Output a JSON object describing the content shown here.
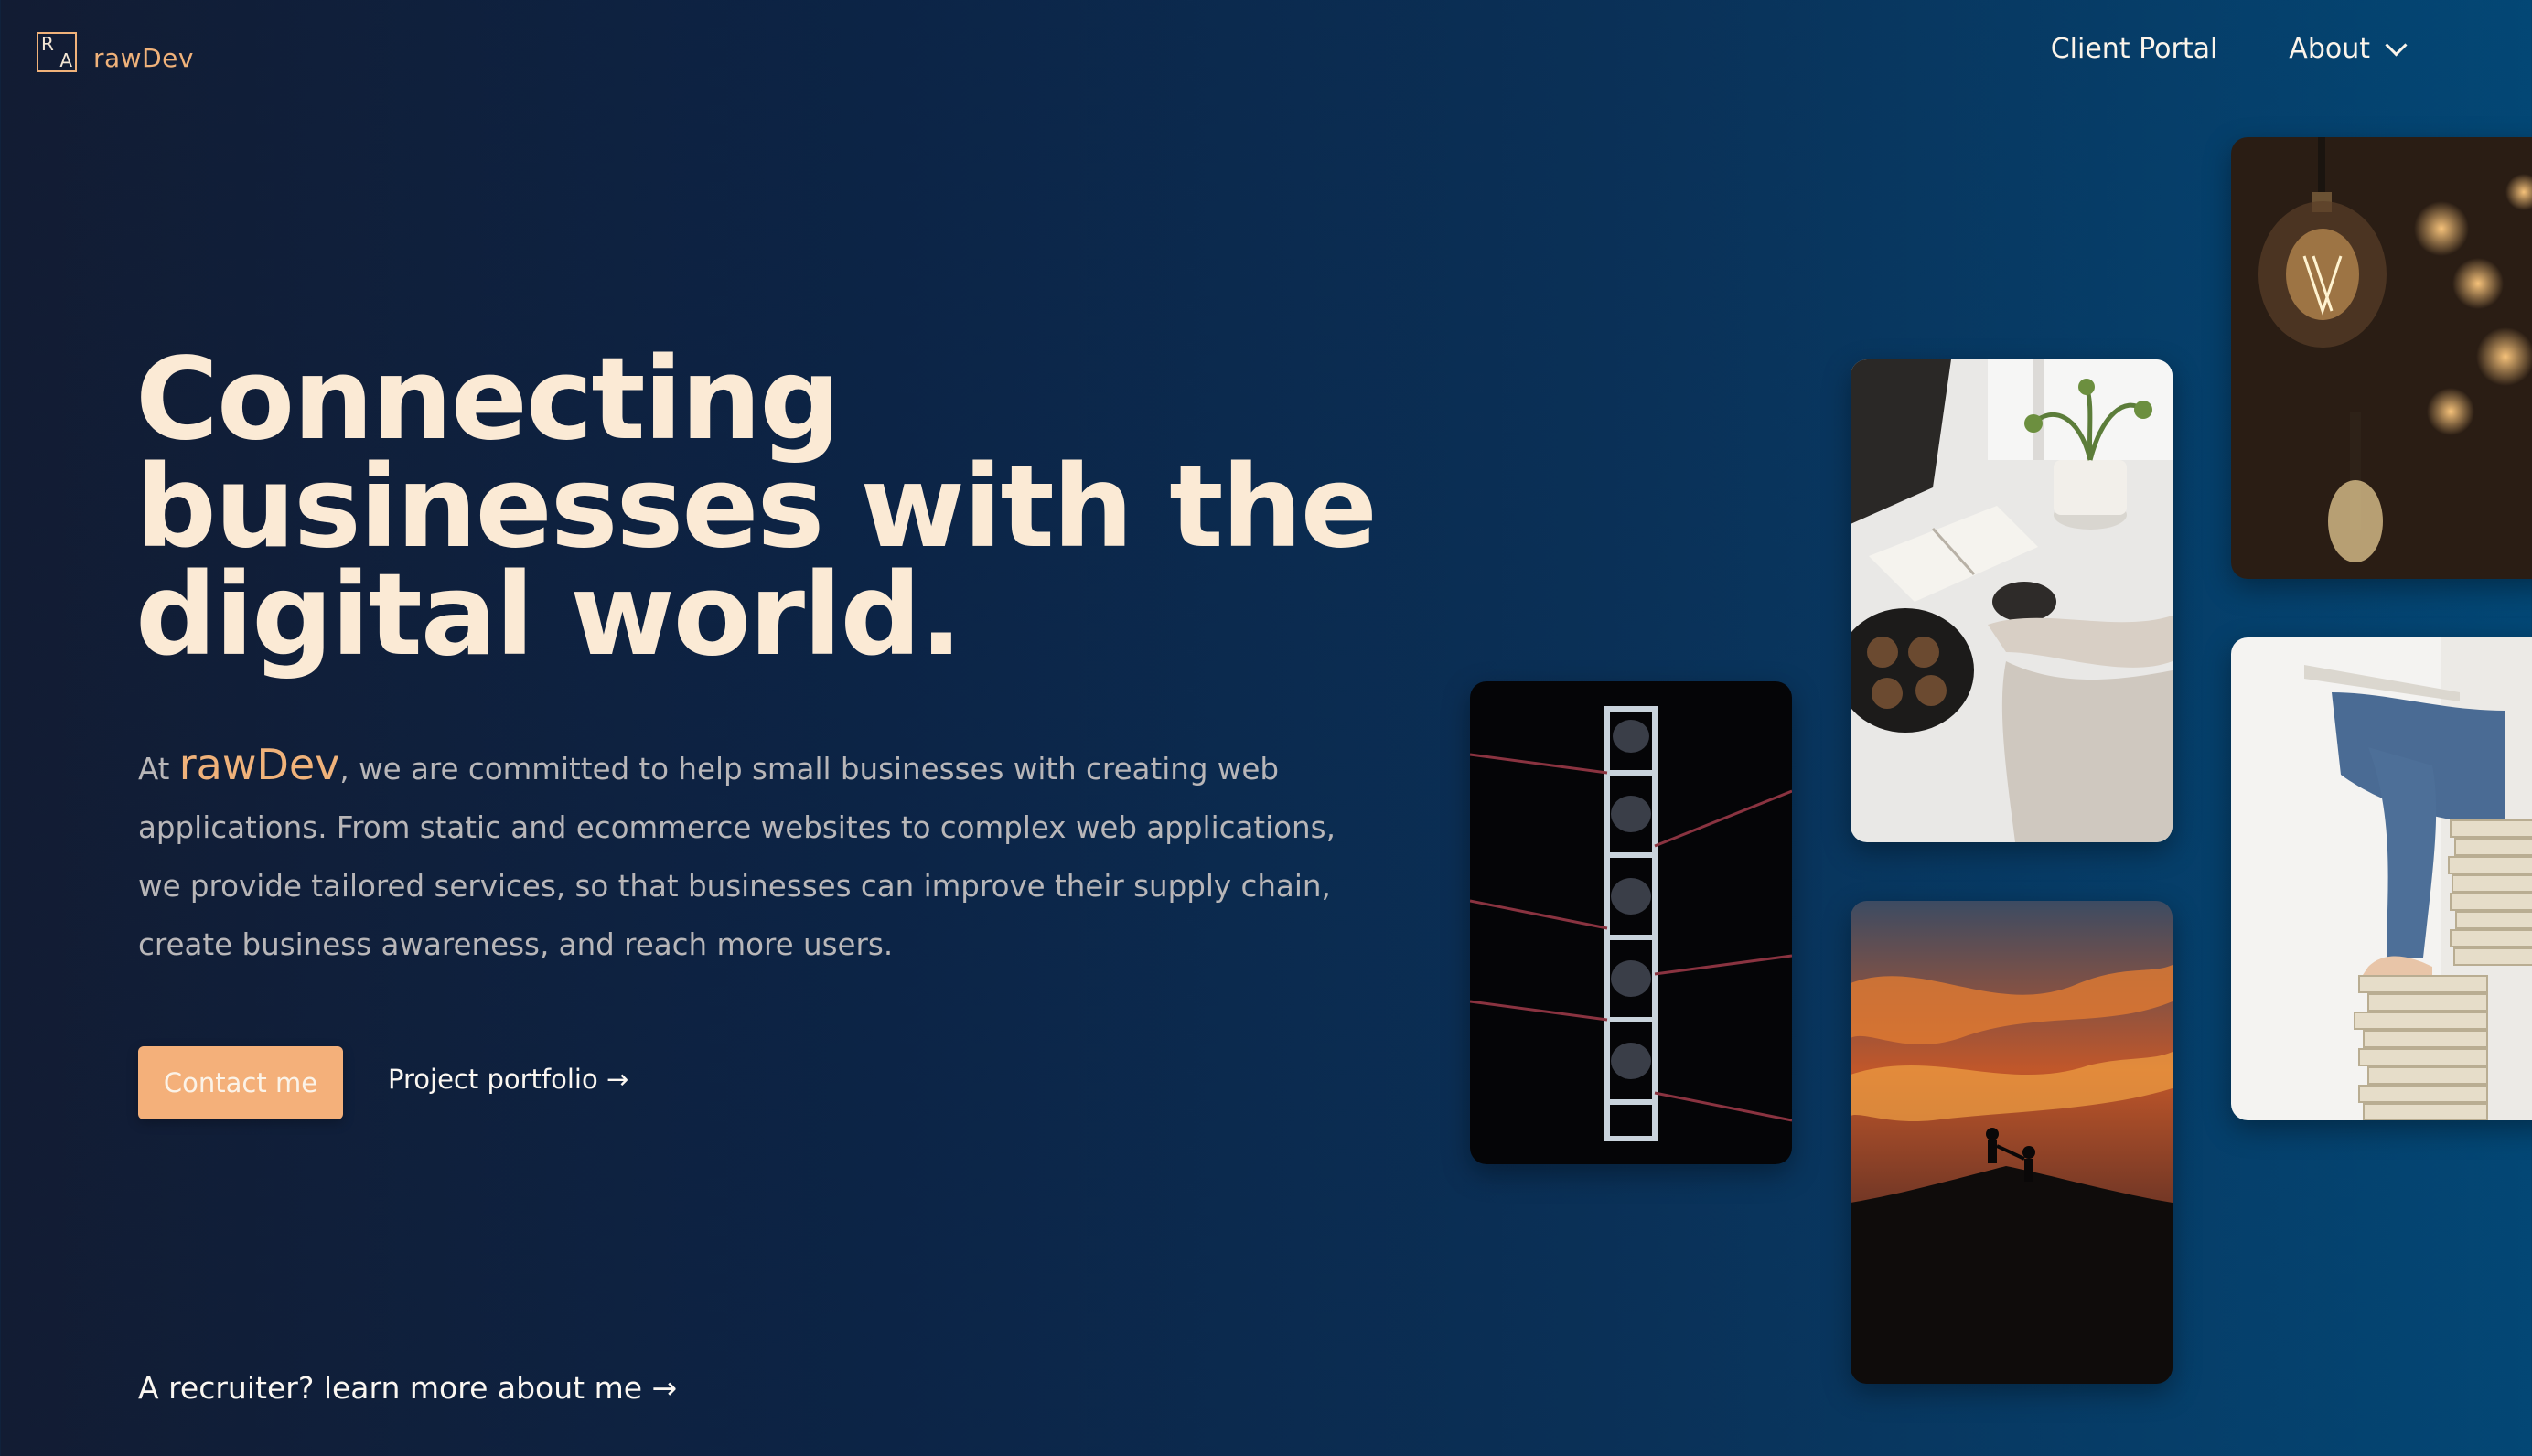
{
  "header": {
    "logo_r": "R",
    "logo_a": "A",
    "logo_text": "rawDev",
    "nav": {
      "client_portal": "Client Portal",
      "about": "About"
    }
  },
  "hero": {
    "title_line1": "Connecting",
    "title_line2": "businesses with the",
    "title_line3": "digital world.",
    "intro_prefix": "At ",
    "brand": "rawDev",
    "intro_body": ", we are committed to help small businesses with creating web applications. From static and ecommerce websites to complex web applications, we provide tailored services, so that businesses can improve their supply chain, create business awareness, and reach more users.",
    "contact_button": "Contact me",
    "portfolio_link": "Project portfolio →",
    "recruiter_link": "A recruiter? learn more about me →"
  },
  "images": {
    "rowers": "rowing-crew-photo",
    "coffee": "coffee-and-book-photo",
    "climb": "sunset-climbers-photo",
    "bulb": "light-bulb-photo",
    "books": "stack-of-books-photo"
  },
  "colors": {
    "accent": "#f0b27a",
    "button": "#f4b07a",
    "headline": "#fbead5",
    "body_text": "#b8b6b8",
    "bg_left": "#121c33",
    "bg_right": "#034775"
  }
}
